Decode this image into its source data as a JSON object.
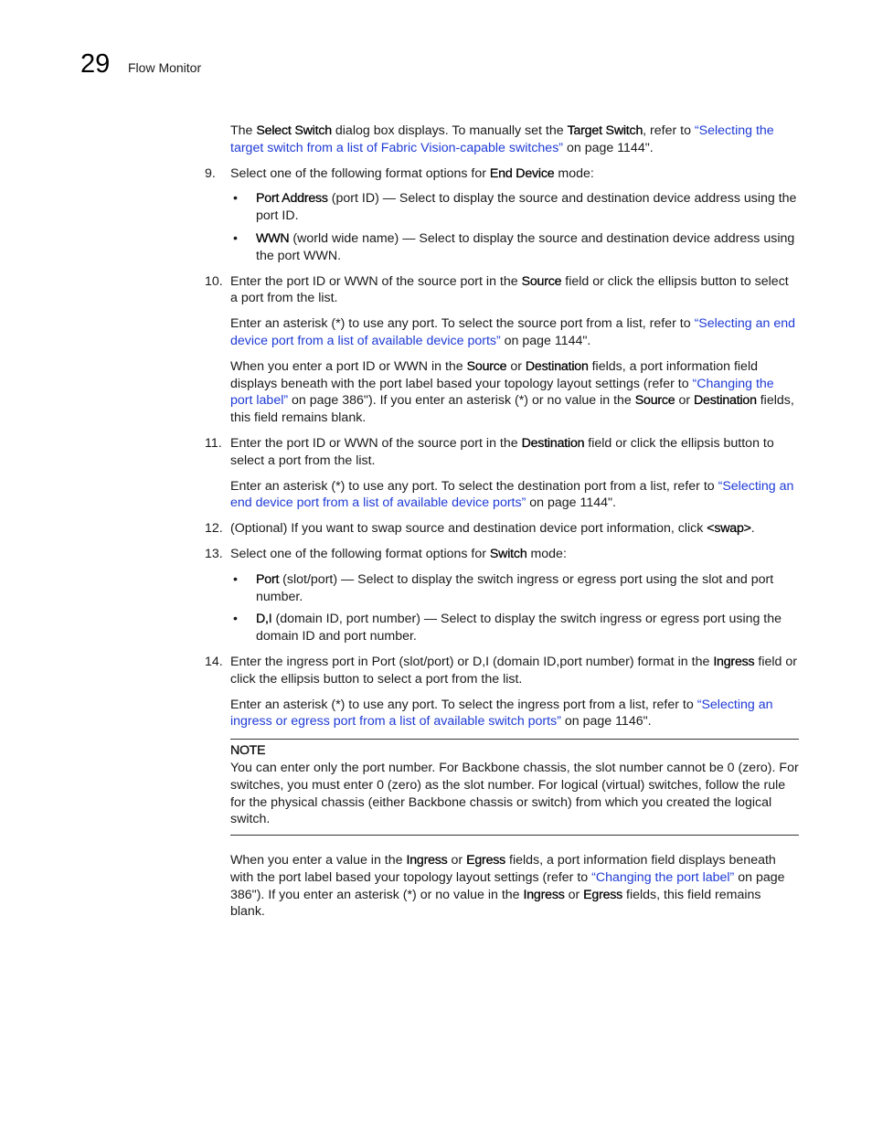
{
  "header": {
    "chapter_number": "29",
    "chapter_title": "Flow Monitor"
  },
  "intro": {
    "t1": "The ",
    "ui1": "Select Switch",
    "t2": " dialog box displays. To manually set the ",
    "ui2": "Target Switch",
    "t3": ", refer to ",
    "link": "“Selecting the target switch from a list of Fabric Vision-capable switches”",
    "t4": " on page 1144\"."
  },
  "step9": {
    "num": "9.",
    "t1": "Select one of the following format options for ",
    "ui1": "End Device",
    "t2": " mode:",
    "bullets": [
      {
        "ui": "Port Address",
        "text": " (port ID) — Select to display the source and destination device address using the port ID."
      },
      {
        "ui": "WWN",
        "text": " (world wide name) — Select to display the source and destination device address using the port WWN."
      }
    ]
  },
  "step10": {
    "num": "10.",
    "t1": "Enter the port ID or WWN of the source port in the ",
    "ui1": "Source",
    "t2": " field or click the ellipsis button to select a port from the list.",
    "p1": {
      "t1": "Enter an asterisk (*) to use any port. To select the source port from a list, refer to ",
      "link": "“Selecting an end device port from a list of available device ports”",
      "t2": " on page 1144\"."
    },
    "p2": {
      "t1": "When you enter a port ID or WWN in the ",
      "ui1": "Source",
      "t2": " or ",
      "ui2": "Destination",
      "t3": " fields, a port information field displays beneath with the port label based your topology layout settings (refer to ",
      "link": "“Changing the port label”",
      "t4": " on page 386\"). If you enter an asterisk (*) or no value in the ",
      "ui3": "Source",
      "t5": " or ",
      "ui4": "Destination",
      "t6": " fields, this field remains blank."
    }
  },
  "step11": {
    "num": "11.",
    "t1": "Enter the port ID or WWN of the source port in the ",
    "ui1": "Destination",
    "t2": " field or click the ellipsis button to select a port from the list.",
    "p1": {
      "t1": "Enter an asterisk (*) to use any port. To select the destination port from a list, refer to ",
      "link": "“Selecting an end device port from a list of available device ports”",
      "t2": " on page 1144\"."
    }
  },
  "step12": {
    "num": "12.",
    "t1": "(Optional) If you want to swap source and destination device port information, click ",
    "ui1": "<swap>",
    "t2": "."
  },
  "step13": {
    "num": "13.",
    "t1": "Select one of the following format options for ",
    "ui1": "Switch",
    "t2": " mode:",
    "bullets": [
      {
        "ui": "Port",
        "text": " (slot/port) — Select to display the switch ingress or egress port using the slot and port number."
      },
      {
        "ui": "D,I",
        "text": " (domain ID, port number) — Select to display the switch ingress or egress port using the domain ID and port number."
      }
    ]
  },
  "step14": {
    "num": "14.",
    "t1": "Enter the ingress port in Port (slot/port) or D,I (domain ID,port number) format in the ",
    "ui1": "Ingress",
    "t2": " field or click the ellipsis button to select a port from the list.",
    "p1": {
      "t1": "Enter an asterisk (*) to use any port. To select the ingress port from a list, refer to ",
      "link": "“Selecting an ingress or egress port from a list of available switch ports”",
      "t2": " on page 1146\"."
    },
    "note": {
      "label": "NOTE",
      "text": "You can enter only the port number. For Backbone chassis, the slot number cannot be 0 (zero). For switches, you must enter 0 (zero) as the slot number. For logical (virtual) switches, follow the rule for the physical chassis (either Backbone chassis or switch) from which you created the logical switch."
    },
    "p2": {
      "t1": "When you enter a value in the ",
      "ui1": "Ingress",
      "t2": " or ",
      "ui2": "Egress",
      "t3": " fields, a port information field displays beneath with the port label based your topology layout settings (refer to ",
      "link": "“Changing the port label”",
      "t4": " on page 386\"). If you enter an asterisk (*) or no value in the ",
      "ui3": "Ingress",
      "t5": " or ",
      "ui4": "Egress",
      "t6": " fields, this field remains blank."
    }
  },
  "bullet_glyph": "•"
}
